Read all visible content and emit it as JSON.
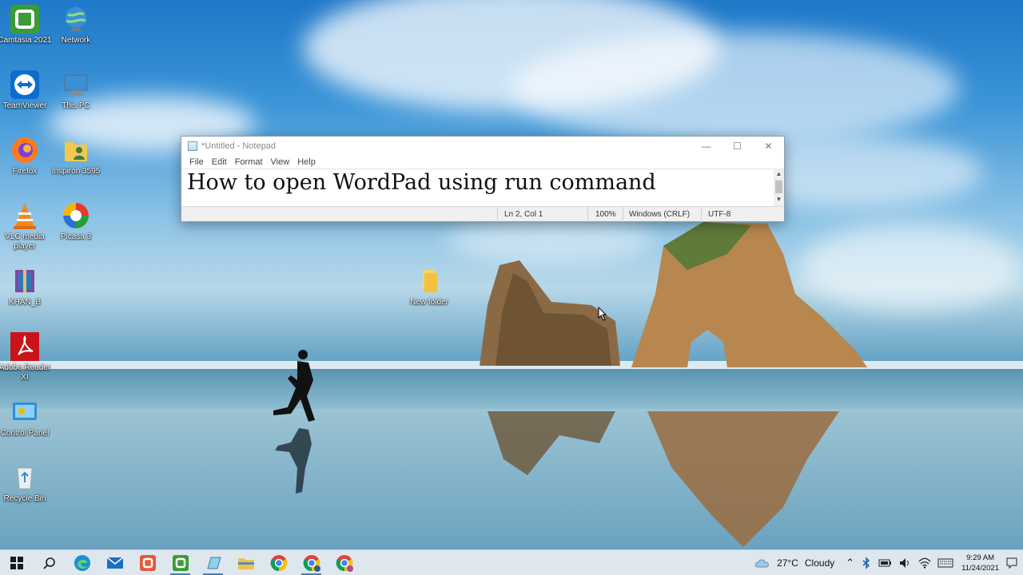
{
  "desktop": {
    "icons_left": [
      {
        "label": "Camtasia 2021",
        "icon": "camtasia-icon"
      },
      {
        "label": "TeamViewer",
        "icon": "teamviewer-icon"
      },
      {
        "label": "Firefox",
        "icon": "firefox-icon"
      },
      {
        "label": "VLC media player",
        "icon": "vlc-icon"
      },
      {
        "label": "KHAN_B",
        "icon": "winrar-icon"
      },
      {
        "label": "Adobe Reader XI",
        "icon": "adobe-reader-icon"
      },
      {
        "label": "Control Panel",
        "icon": "control-panel-icon"
      },
      {
        "label": "Recycle Bin",
        "icon": "recycle-bin-icon"
      }
    ],
    "icons_right": [
      {
        "label": "Network",
        "icon": "network-icon"
      },
      {
        "label": "This PC",
        "icon": "this-pc-icon"
      },
      {
        "label": "Inspiron 3595",
        "icon": "user-folder-icon"
      },
      {
        "label": "Picasa 3",
        "icon": "picasa-icon"
      }
    ],
    "folder": {
      "label": "New folder",
      "icon": "folder-icon"
    }
  },
  "notepad": {
    "title": "*Untitled - Notepad",
    "menu": [
      "File",
      "Edit",
      "Format",
      "View",
      "Help"
    ],
    "content": "How to open WordPad using run command",
    "status": {
      "position": "Ln 2, Col 1",
      "zoom": "100%",
      "line_ending": "Windows (CRLF)",
      "encoding": "UTF-8"
    }
  },
  "taskbar": {
    "apps": [
      "start-icon",
      "search-icon",
      "edge-icon",
      "mail-icon",
      "camtasia-recorder-icon",
      "camtasia-icon",
      "notepad-icon",
      "file-explorer-icon",
      "chrome-icon",
      "chrome-profile-icon",
      "chrome-profile-2-icon"
    ],
    "weather": {
      "temp": "27°C",
      "condition": "Cloudy"
    },
    "time": "9:29 AM",
    "date": "11/24/2021"
  }
}
